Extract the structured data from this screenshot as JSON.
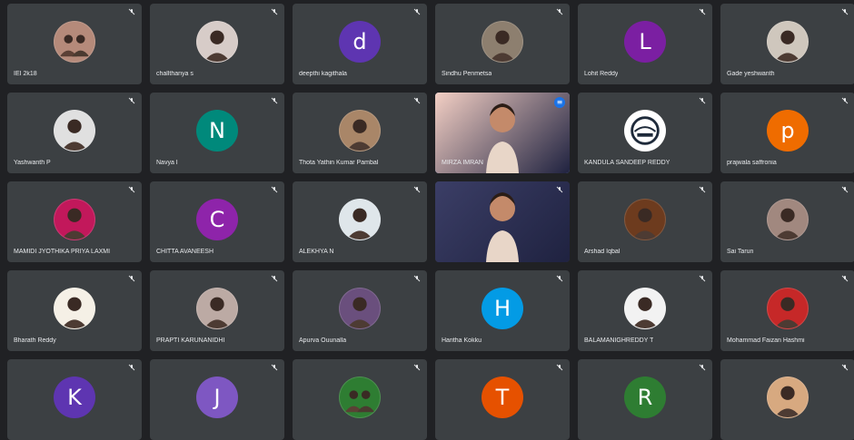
{
  "participants": [
    {
      "name": "IEI 2k18",
      "avatar": "photo",
      "bg": "#b58a7a",
      "icon": "group-photo"
    },
    {
      "name": "challthanya s",
      "avatar": "photo",
      "bg": "#d7ccc8",
      "icon": "person-photo"
    },
    {
      "name": "deepthi kagithala",
      "avatar": "letter",
      "letter": "d",
      "bg": "#5e35b1"
    },
    {
      "name": "Sindhu Penmetsa",
      "avatar": "photo",
      "bg": "#8d7f6f",
      "icon": "person-photo"
    },
    {
      "name": "Lohit Reddy",
      "avatar": "letter",
      "letter": "L",
      "bg": "#7b1fa2"
    },
    {
      "name": "Gade yeshwanth",
      "avatar": "photo",
      "bg": "#cfc7bd",
      "icon": "person-photo"
    },
    {
      "name": "Yashwanth P",
      "avatar": "photo",
      "bg": "#e0e0e0",
      "icon": "person-photo"
    },
    {
      "name": "Navya I",
      "avatar": "letter",
      "letter": "N",
      "bg": "#00897b"
    },
    {
      "name": "Thota Yathin Kumar Pambal",
      "avatar": "photo",
      "bg": "#a98668",
      "icon": "person-photo"
    },
    {
      "name": "MIRZA IMRAN",
      "avatar": "video",
      "bg": "#f3cfc4",
      "active": true
    },
    {
      "name": "KANDULA SANDEEP REDDY",
      "avatar": "photo",
      "bg": "#ffffff",
      "icon": "logo-photo"
    },
    {
      "name": "prajwala saffronia",
      "avatar": "letter",
      "letter": "p",
      "bg": "#ef6c00"
    },
    {
      "name": "MAMIDI JYOTHIKA PRIYA LAXMI",
      "avatar": "photo",
      "bg": "#c2185b",
      "icon": "person-photo"
    },
    {
      "name": "CHITTA AVANEESH",
      "avatar": "letter",
      "letter": "C",
      "bg": "#8e24aa"
    },
    {
      "name": "ALEKHYA N",
      "avatar": "photo",
      "bg": "#dfe6ea",
      "icon": "person-photo"
    },
    {
      "name": "",
      "avatar": "video",
      "bg": "#3b3e66"
    },
    {
      "name": "Arshad Iqbal",
      "avatar": "photo",
      "bg": "#6d3b1e",
      "icon": "person-photo"
    },
    {
      "name": "Sai Tarun",
      "avatar": "photo",
      "bg": "#a1887f",
      "icon": "person-photo"
    },
    {
      "name": "Bharath Reddy",
      "avatar": "photo",
      "bg": "#f5f0e6",
      "icon": "person-photo"
    },
    {
      "name": "PRAPTI KARUNANIDHI",
      "avatar": "photo",
      "bg": "#bcaaa4",
      "icon": "person-photo"
    },
    {
      "name": "Apurva Ouunalla",
      "avatar": "photo",
      "bg": "#6a4f7d",
      "icon": "person-photo"
    },
    {
      "name": "Haritha Kokku",
      "avatar": "letter",
      "letter": "H",
      "bg": "#039be5"
    },
    {
      "name": "BALAMANIGHREDDY T",
      "avatar": "photo",
      "bg": "#f2f2f2",
      "icon": "person-photo"
    },
    {
      "name": "Mohammad Faizan Hashmi",
      "avatar": "photo",
      "bg": "#c62828",
      "icon": "person-photo"
    },
    {
      "name": "",
      "avatar": "letter",
      "letter": "K",
      "bg": "#5e35b1"
    },
    {
      "name": "",
      "avatar": "letter",
      "letter": "J",
      "bg": "#7e57c2"
    },
    {
      "name": "",
      "avatar": "photo",
      "bg": "#2e7d32",
      "icon": "group-photo"
    },
    {
      "name": "",
      "avatar": "letter",
      "letter": "T",
      "bg": "#e65100"
    },
    {
      "name": "",
      "avatar": "letter",
      "letter": "R",
      "bg": "#2e7d32"
    },
    {
      "name": "",
      "avatar": "photo",
      "bg": "#d7a980",
      "icon": "person-photo"
    }
  ],
  "icons": {
    "mute": "mic-off-icon",
    "speaking": "speaking-icon"
  }
}
